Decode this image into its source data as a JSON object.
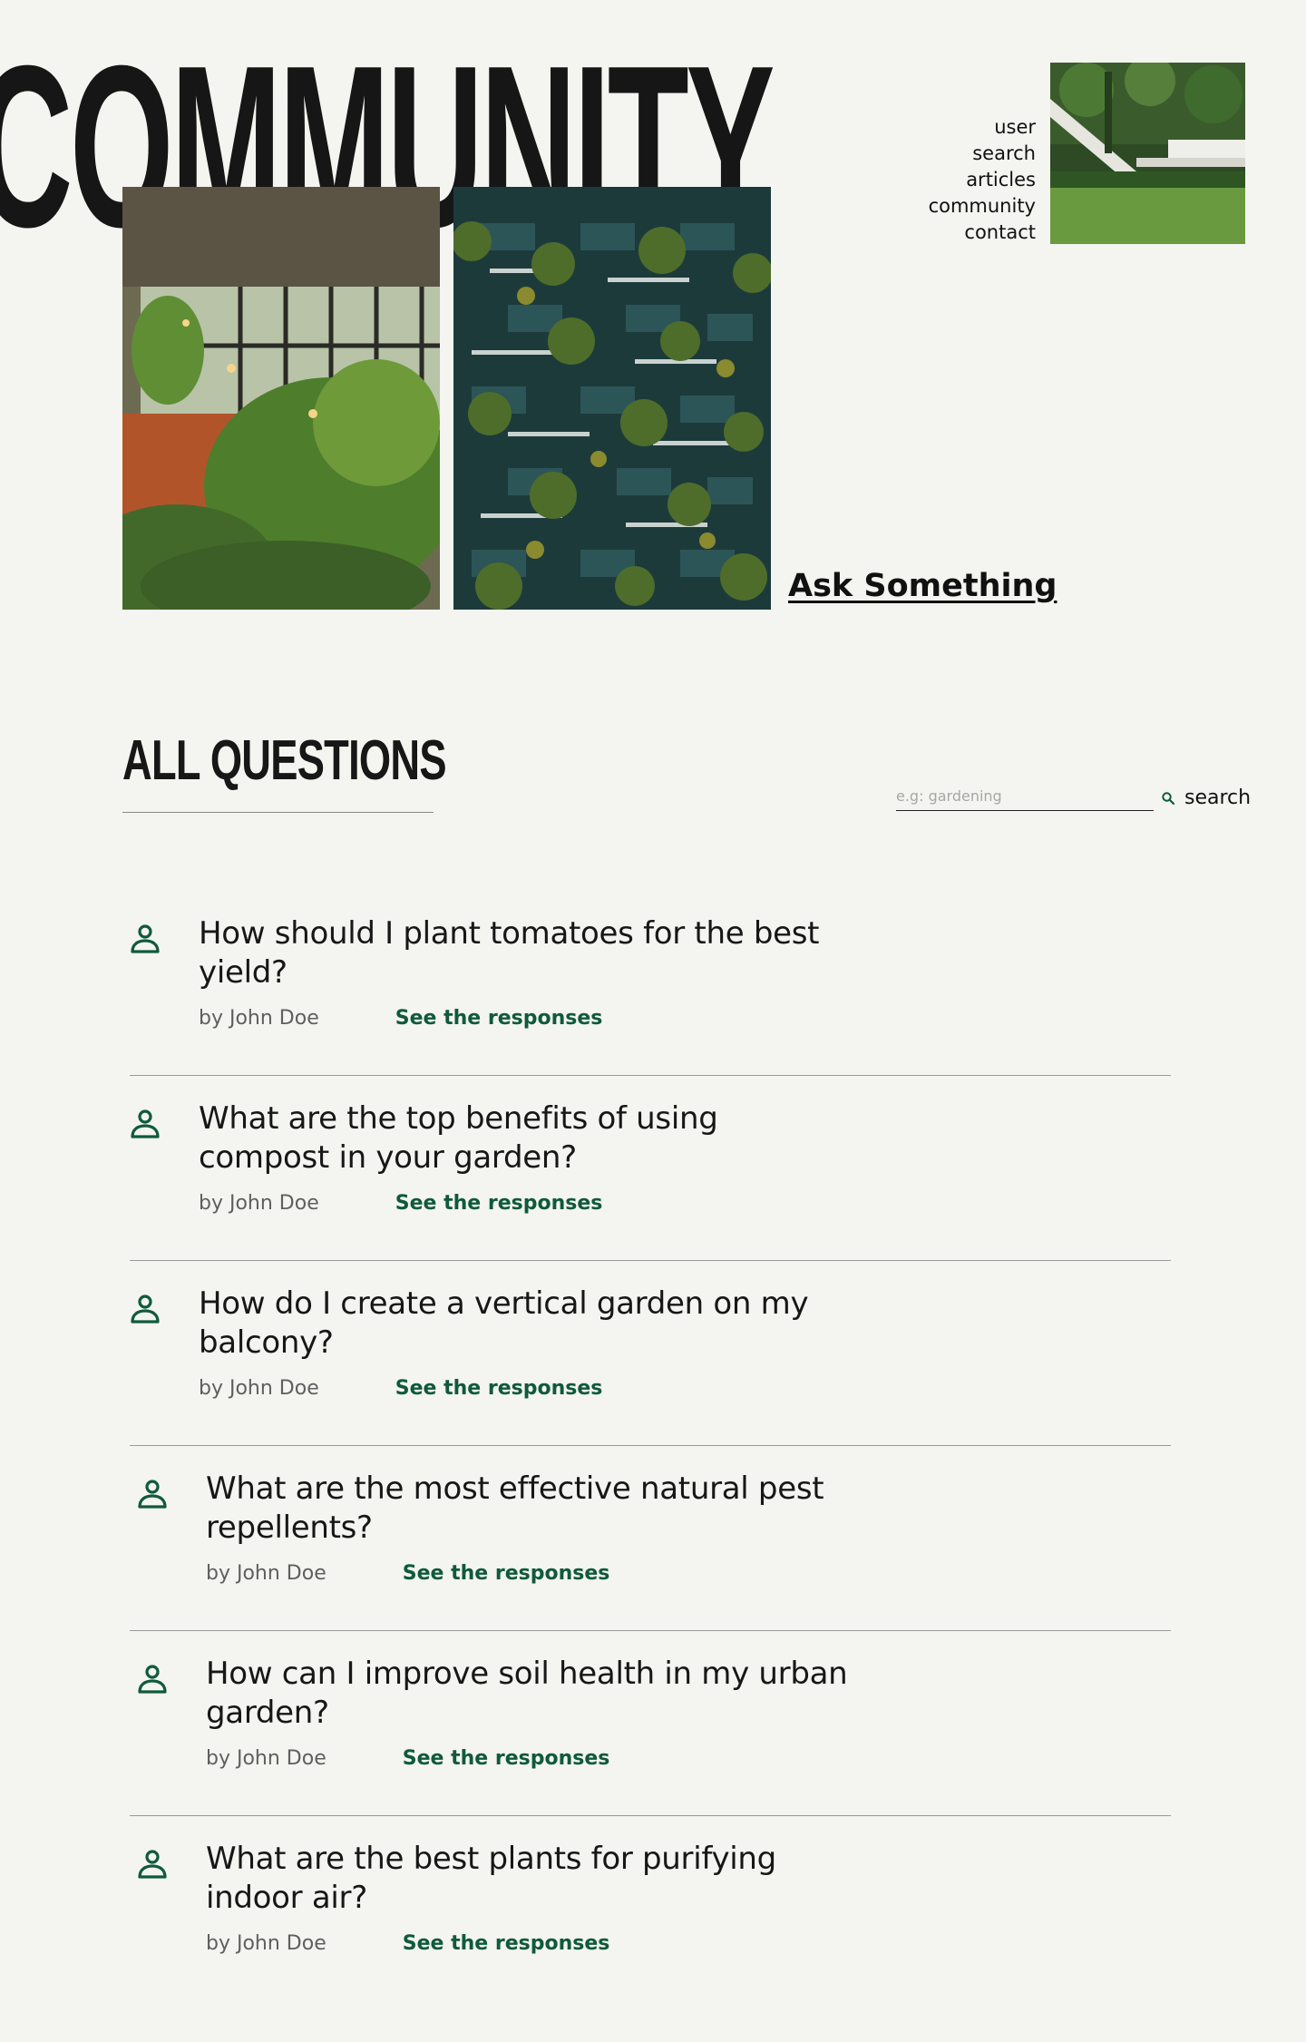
{
  "hero": {
    "title": "COMMUNITY",
    "ask_label": "Ask Something"
  },
  "nav": {
    "items": [
      "user",
      "search",
      "articles",
      "community",
      "contact"
    ]
  },
  "section": {
    "title": "ALL QUESTIONS"
  },
  "search": {
    "placeholder": "e.g: gardening",
    "button_label": "search",
    "icon": "search-icon"
  },
  "questions": [
    {
      "title": "How should I plant tomatoes for the best yield?",
      "author": "by John Doe",
      "link": "See the responses"
    },
    {
      "title": "What are the top benefits of using compost in your garden?",
      "author": "by John Doe",
      "link": "See the responses"
    },
    {
      "title": "How do I create a vertical garden on my balcony?",
      "author": "by John Doe",
      "link": "See the responses"
    },
    {
      "title": "What are the most effective natural pest repellents?",
      "author": "by John Doe",
      "link": "See the responses"
    },
    {
      "title": "How can I improve soil health in my urban garden?",
      "author": "by John Doe",
      "link": "See the responses"
    },
    {
      "title": "What are the best plants for purifying indoor air?",
      "author": "by John Doe",
      "link": "See the responses"
    }
  ],
  "colors": {
    "background": "#f4f4f0",
    "text": "#171717",
    "accent": "#0f5a3a",
    "muted": "#5f5f5f"
  }
}
